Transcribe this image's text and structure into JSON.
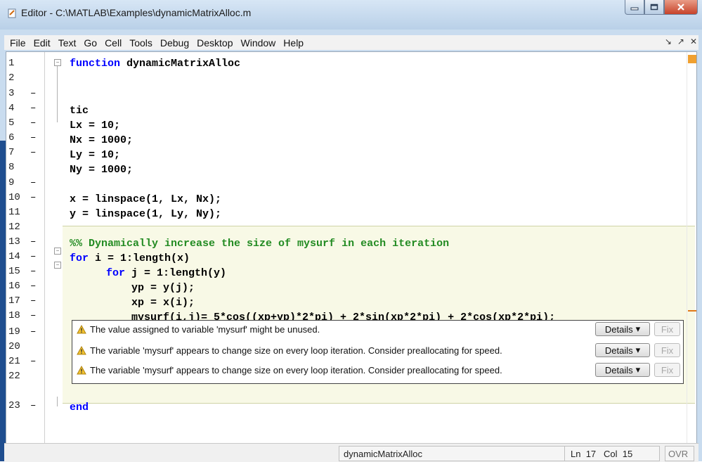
{
  "window": {
    "title": "Editor - C:\\MATLAB\\Examples\\dynamicMatrixAlloc.m"
  },
  "menu": [
    "File",
    "Edit",
    "Text",
    "Go",
    "Cell",
    "Tools",
    "Debug",
    "Desktop",
    "Window",
    "Help"
  ],
  "code_lines": [
    {
      "n": "1",
      "dash": ""
    },
    {
      "n": "2",
      "dash": ""
    },
    {
      "n": "3",
      "dash": "–"
    },
    {
      "n": "4",
      "dash": "–"
    },
    {
      "n": "5",
      "dash": "–"
    },
    {
      "n": "6",
      "dash": "–"
    },
    {
      "n": "7",
      "dash": "–"
    },
    {
      "n": "8",
      "dash": ""
    },
    {
      "n": "9",
      "dash": "–"
    },
    {
      "n": "10",
      "dash": "–"
    },
    {
      "n": "11",
      "dash": ""
    },
    {
      "n": "12",
      "dash": ""
    },
    {
      "n": "13",
      "dash": "–"
    },
    {
      "n": "14",
      "dash": "–"
    },
    {
      "n": "15",
      "dash": "–"
    },
    {
      "n": "16",
      "dash": "–"
    },
    {
      "n": "17",
      "dash": "–"
    },
    {
      "n": "18",
      "dash": "–"
    },
    {
      "n": "19",
      "dash": "–"
    },
    {
      "n": "20",
      "dash": ""
    },
    {
      "n": "21",
      "dash": "–"
    },
    {
      "n": "22",
      "dash": ""
    },
    {
      "n": "23",
      "dash": "–"
    }
  ],
  "code": {
    "l1_kw": "function",
    "l1_rest": " dynamicMatrixAlloc",
    "l3": "tic",
    "l4": "Lx = 10;",
    "l5": "Nx = 1000;",
    "l6": "Ly = 10;",
    "l7": "Ny = 1000;",
    "l9": "x = linspace(1, Lx, Nx);",
    "l10": "y = linspace(1, Ly, Ny);",
    "l12": "%% Dynamically increase the size of mysurf in each iteration",
    "l13_kw": "for",
    "l13_rest": " i = 1:length(x)",
    "l14_kw": "for",
    "l14_rest": " j = 1:length(y)",
    "l15": "yp = y(j);",
    "l16": "xp = x(i);",
    "l17": "mysurf(i,j)= 5*cos((xp+yp)*2*pi) + 2*sin(xp*2*pi) + 2*cos(xp*2*pi);",
    "l23": "end"
  },
  "tooltip": {
    "msg1": "The value assigned to variable 'mysurf' might be unused.",
    "msg2": "The variable 'mysurf' appears to change size on every loop iteration. Consider preallocating for speed.",
    "msg3": "The variable 'mysurf' appears to change size on every loop iteration. Consider preallocating for speed.",
    "details_label": "Details",
    "fix_label": "Fix"
  },
  "status": {
    "function_name": "dynamicMatrixAlloc",
    "ln_label": "Ln",
    "ln": "17",
    "col_label": "Col",
    "col": "15",
    "ovr": "OVR"
  },
  "colors": {
    "keyword": "#0000ff",
    "comment": "#228b22",
    "cell_highlight": "#f8f9e6",
    "warning": "#f0a030"
  }
}
